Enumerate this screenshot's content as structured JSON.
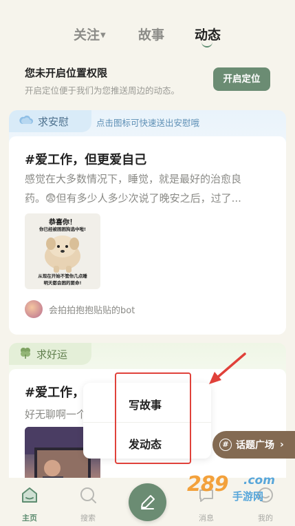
{
  "tabs": {
    "follow": "关注",
    "story": "故事",
    "dynamic": "动态",
    "active": "dynamic"
  },
  "location": {
    "title": "您未开启位置权限",
    "description": "开启定位便于我们为您推送周边的动态。",
    "button": "开启定位"
  },
  "cards": [
    {
      "badge": "求安慰",
      "hint": "点击图标可快速送出安慰哦",
      "title": "#爱工作，但更爱自己",
      "body": "感觉在大多数情况下，睡觉，就是最好的治愈良药。😨但有多少人多少次说了晚安之后，过了...",
      "meme": {
        "line1": "恭喜你！",
        "line2": "你已经被困困狗选中啦!",
        "line3": "从现在开始不管你几点睡\n明天都会困的要命!"
      },
      "author": "会拍拍抱抱贴贴的bot"
    },
    {
      "badge": "求好运",
      "title": "#爱工作，",
      "body": "好无聊啊一个"
    }
  ],
  "popup": {
    "write_story": "写故事",
    "post_dynamic": "发动态"
  },
  "topic_square": "话题广场",
  "nav": {
    "home": "主页",
    "search": "搜索",
    "messages": "消息",
    "me": "我的"
  },
  "watermark": {
    "number": "289",
    "domain": ".com",
    "text": "手游网"
  },
  "colors": {
    "accent": "#6b8c73",
    "highlight_red": "#e0413a",
    "background": "#f6f4ec"
  }
}
